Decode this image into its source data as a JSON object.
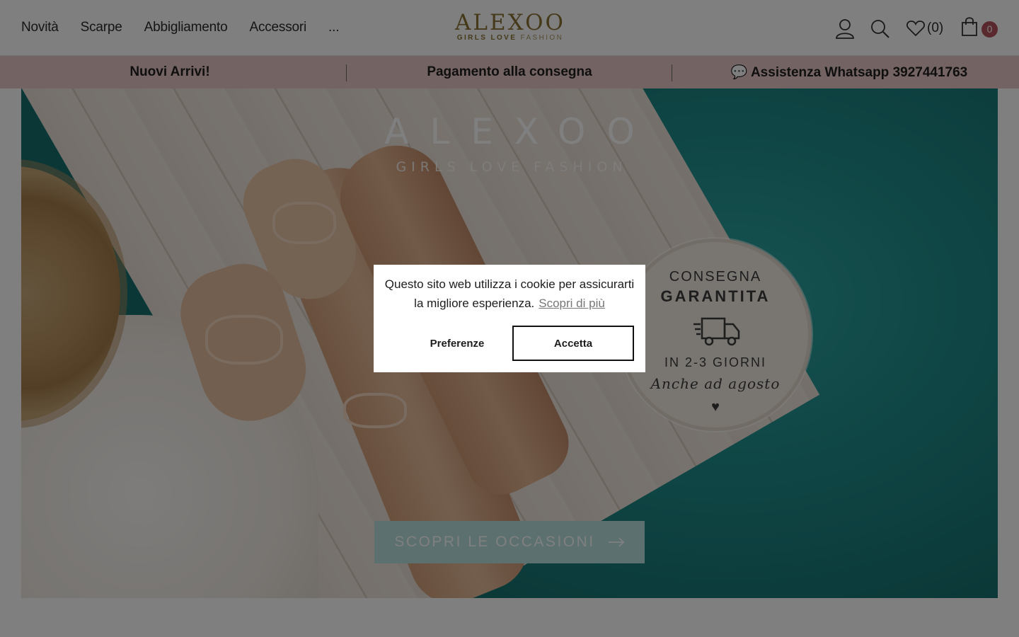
{
  "nav": {
    "items": [
      {
        "label": "Novità"
      },
      {
        "label": "Scarpe"
      },
      {
        "label": "Abbigliamento"
      },
      {
        "label": "Accessori"
      },
      {
        "label": "..."
      }
    ]
  },
  "logo": {
    "main": "ALEXOO",
    "sub_bold": "GIRLS LOVE ",
    "sub_light": "FASHION"
  },
  "header_icons": {
    "account_icon": "user-icon",
    "search_icon": "search-icon",
    "wishlist_icon": "heart-icon",
    "wishlist_count": "(0)",
    "cart_icon": "shopping-bag-icon",
    "cart_count": "0"
  },
  "promo": {
    "items": [
      {
        "label": "Nuovi Arrivi!"
      },
      {
        "label": "Pagamento alla consegna"
      },
      {
        "label": "💬 Assistenza Whatsapp 3927441763"
      }
    ],
    "background": "#e9c6c6"
  },
  "hero": {
    "title": "ALEXOO",
    "subtitle": "GIRLS LOVE FASHION",
    "badge": {
      "line1": "CONSEGNA",
      "line2": "GARANTITA",
      "line3": "IN 2-3 GIORNI",
      "line4": "Anche ad agosto",
      "truck_icon": "delivery-truck-icon",
      "heart_icon": "heart-icon"
    },
    "cta_label": "SCOPRI LE OCCASIONI",
    "cta_icon": "arrow-right-icon"
  },
  "cookie": {
    "text": "Questo sito web utilizza i cookie per assicurarti la migliore esperienza.",
    "link": "Scopri di più",
    "preferences_label": "Preferenze",
    "accept_label": "Accetta"
  },
  "colors": {
    "accent": "#8a7334",
    "badge": "#b5525a",
    "cta": "#b6e1df"
  }
}
